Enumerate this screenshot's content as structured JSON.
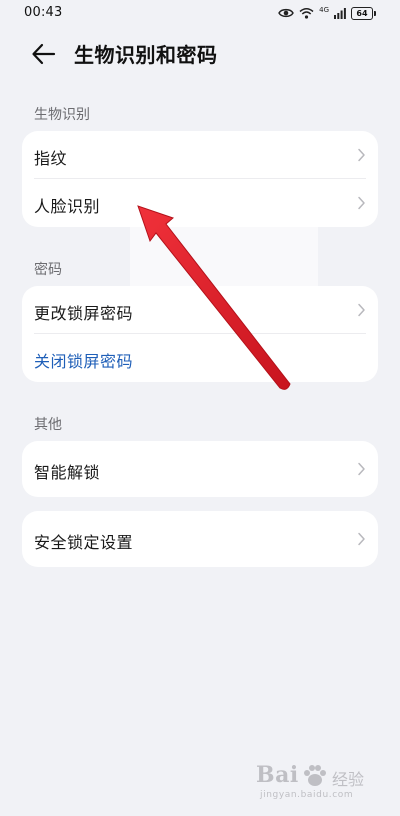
{
  "status_bar": {
    "time": "00:43",
    "battery_level": "64",
    "signal_label": "4G"
  },
  "header": {
    "title": "生物识别和密码"
  },
  "sections": {
    "biometrics": {
      "label": "生物识别",
      "items": [
        {
          "label": "指纹"
        },
        {
          "label": "人脸识别"
        }
      ]
    },
    "password": {
      "label": "密码",
      "items": [
        {
          "label": "更改锁屏密码"
        },
        {
          "label": "关闭锁屏密码"
        }
      ]
    },
    "other": {
      "label": "其他",
      "items": [
        {
          "label": "智能解锁"
        }
      ]
    },
    "security": {
      "items": [
        {
          "label": "安全锁定设置"
        }
      ]
    }
  },
  "annotation": {
    "arrow_color": "#e0212b"
  },
  "watermark": {
    "main": "Bai",
    "cn": "经验",
    "sub": "jingyan.baidu.com"
  },
  "colors": {
    "background": "#f1f2f6",
    "card": "#ffffff",
    "link": "#1f5fb8",
    "section_label": "#6c6c70"
  }
}
